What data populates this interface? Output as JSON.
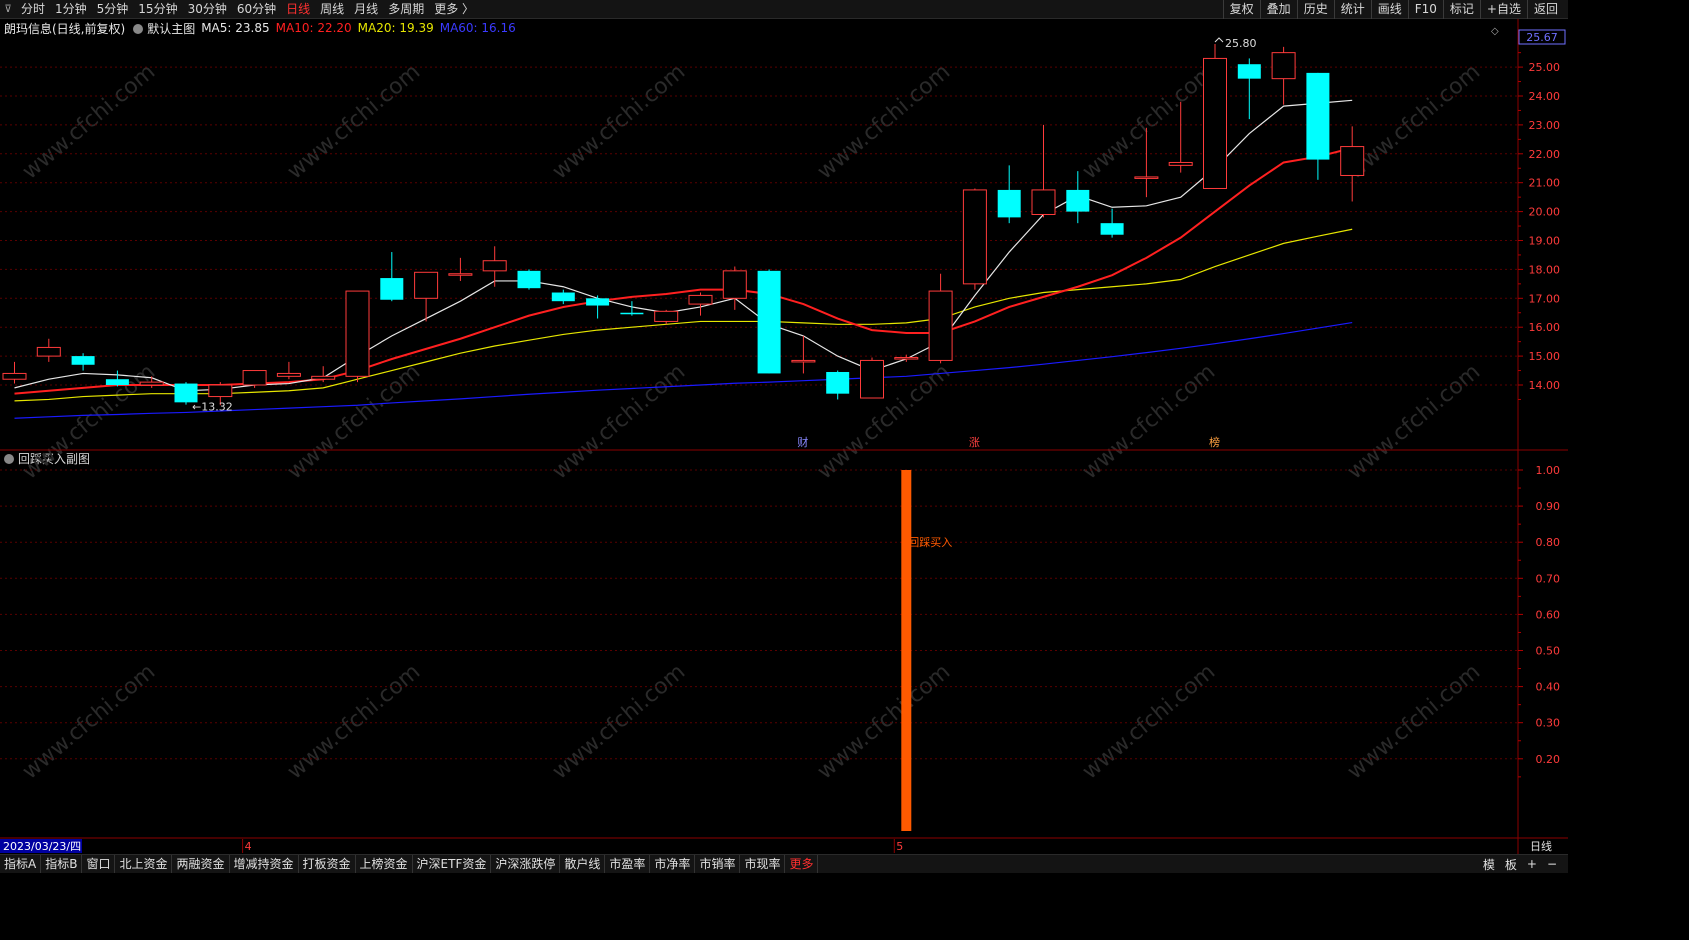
{
  "toolbar": {
    "left": [
      "分时",
      "1分钟",
      "5分钟",
      "15分钟",
      "30分钟",
      "60分钟",
      "日线",
      "周线",
      "月线",
      "多周期",
      "更多 〉"
    ],
    "active": "日线",
    "right": [
      "复权",
      "叠加",
      "历史",
      "统计",
      "画线",
      "F10",
      "标记",
      "+自选",
      "返回"
    ]
  },
  "header": {
    "stock": "朗玛信息(日线,前复权)",
    "main_label": "默认主图",
    "ma5": "MA5: 23.85",
    "ma10": "MA10: 22.20",
    "ma20": "MA20: 19.39",
    "ma60": "MA60: 16.16"
  },
  "subchart_title": "回踩买入副图",
  "bottom_tabs": [
    "指标A",
    "指标B",
    "窗口",
    "北上资金",
    "两融资金",
    "增减持资金",
    "打板资金",
    "上榜资金",
    "沪深ETF资金",
    "沪深涨跌停",
    "散户线",
    "市盈率",
    "市净率",
    "市销率",
    "市现率",
    "更多"
  ],
  "bottom_right": [
    "模",
    "板",
    "+",
    "−"
  ],
  "watermark": "www.cfchi.com",
  "colors": {
    "up": "#ff3b3b",
    "down": "#00ffff",
    "ma5": "#e6e6e6",
    "ma10": "#ff2020",
    "ma20": "#e6e600",
    "ma60": "#1a1aff",
    "signal": "#ff5a00"
  },
  "chart_data": [
    {
      "type": "candlestick",
      "ylim": [
        13.0,
        25.67
      ],
      "y_ticks": [
        "25.00",
        "24.00",
        "23.00",
        "22.00",
        "21.00",
        "20.00",
        "19.00",
        "18.00",
        "17.00",
        "16.00",
        "15.00",
        "14.00"
      ],
      "last_price_label": "25.67",
      "candles": [
        {
          "o": 14.2,
          "h": 14.8,
          "l": 14.05,
          "c": 14.4
        },
        {
          "o": 15.0,
          "h": 15.6,
          "l": 14.8,
          "c": 15.3
        },
        {
          "o": 15.0,
          "h": 15.1,
          "l": 14.5,
          "c": 14.7
        },
        {
          "o": 14.2,
          "h": 14.5,
          "l": 13.95,
          "c": 14.0
        },
        {
          "o": 14.0,
          "h": 14.3,
          "l": 13.9,
          "c": 14.1
        },
        {
          "o": 14.05,
          "h": 14.1,
          "l": 13.32,
          "c": 13.4
        },
        {
          "o": 13.6,
          "h": 14.1,
          "l": 13.3,
          "c": 14.0
        },
        {
          "o": 14.0,
          "h": 14.5,
          "l": 13.9,
          "c": 14.5
        },
        {
          "o": 14.3,
          "h": 14.8,
          "l": 14.2,
          "c": 14.4
        },
        {
          "o": 14.2,
          "h": 14.65,
          "l": 14.1,
          "c": 14.3
        },
        {
          "o": 14.3,
          "h": 17.25,
          "l": 14.1,
          "c": 17.25
        },
        {
          "o": 17.7,
          "h": 18.6,
          "l": 16.9,
          "c": 16.95
        },
        {
          "o": 17.0,
          "h": 17.9,
          "l": 16.2,
          "c": 17.9
        },
        {
          "o": 17.8,
          "h": 18.4,
          "l": 17.6,
          "c": 17.85
        },
        {
          "o": 17.95,
          "h": 18.8,
          "l": 17.4,
          "c": 18.3
        },
        {
          "o": 17.95,
          "h": 18.0,
          "l": 17.3,
          "c": 17.35
        },
        {
          "o": 17.2,
          "h": 17.3,
          "l": 16.8,
          "c": 16.9
        },
        {
          "o": 17.0,
          "h": 17.1,
          "l": 16.3,
          "c": 16.75
        },
        {
          "o": 16.5,
          "h": 16.9,
          "l": 16.4,
          "c": 16.45
        },
        {
          "o": 16.2,
          "h": 16.6,
          "l": 16.1,
          "c": 16.55
        },
        {
          "o": 16.8,
          "h": 17.2,
          "l": 16.4,
          "c": 17.1
        },
        {
          "o": 17.0,
          "h": 18.1,
          "l": 16.6,
          "c": 17.95
        },
        {
          "o": 17.95,
          "h": 18.0,
          "l": 14.4,
          "c": 14.4
        },
        {
          "o": 14.85,
          "h": 15.7,
          "l": 14.4,
          "c": 14.85
        },
        {
          "o": 14.45,
          "h": 14.5,
          "l": 13.5,
          "c": 13.7
        },
        {
          "o": 13.55,
          "h": 14.95,
          "l": 13.55,
          "c": 14.85
        },
        {
          "o": 14.9,
          "h": 15.05,
          "l": 14.8,
          "c": 14.95
        },
        {
          "o": 14.85,
          "h": 17.85,
          "l": 14.75,
          "c": 17.25
        },
        {
          "o": 17.5,
          "h": 20.8,
          "l": 17.3,
          "c": 20.75
        },
        {
          "o": 20.75,
          "h": 21.6,
          "l": 19.6,
          "c": 19.8
        },
        {
          "o": 19.9,
          "h": 23.0,
          "l": 19.8,
          "c": 20.75
        },
        {
          "o": 20.75,
          "h": 21.4,
          "l": 19.6,
          "c": 20.0
        },
        {
          "o": 19.6,
          "h": 20.1,
          "l": 19.1,
          "c": 19.2
        },
        {
          "o": 21.15,
          "h": 22.9,
          "l": 20.5,
          "c": 21.2
        },
        {
          "o": 21.6,
          "h": 23.8,
          "l": 21.35,
          "c": 21.7
        },
        {
          "o": 20.8,
          "h": 25.8,
          "l": 20.8,
          "c": 25.3
        },
        {
          "o": 25.1,
          "h": 25.3,
          "l": 23.2,
          "c": 24.6
        },
        {
          "o": 24.6,
          "h": 25.7,
          "l": 23.7,
          "c": 25.5
        },
        {
          "o": 24.8,
          "h": 24.8,
          "l": 21.1,
          "c": 21.8
        },
        {
          "o": 21.25,
          "h": 22.95,
          "l": 20.35,
          "c": 22.25
        }
      ],
      "ma5": [
        13.9,
        14.2,
        14.4,
        14.35,
        14.25,
        13.8,
        13.85,
        14.0,
        14.05,
        14.25,
        15.0,
        15.7,
        16.3,
        16.9,
        17.6,
        17.6,
        17.4,
        17.0,
        16.7,
        16.5,
        16.7,
        17.0,
        16.1,
        15.7,
        15.0,
        14.5,
        14.9,
        15.5,
        17.1,
        18.6,
        19.9,
        20.55,
        20.15,
        20.2,
        20.5,
        21.5,
        22.7,
        23.65,
        23.75,
        23.85
      ],
      "ma10": [
        13.7,
        13.8,
        13.9,
        14.0,
        14.0,
        14.0,
        14.0,
        14.05,
        14.1,
        14.2,
        14.5,
        14.9,
        15.25,
        15.6,
        16.0,
        16.4,
        16.7,
        16.9,
        17.05,
        17.15,
        17.3,
        17.3,
        17.15,
        16.8,
        16.3,
        15.9,
        15.8,
        15.8,
        16.2,
        16.7,
        17.05,
        17.4,
        17.8,
        18.4,
        19.1,
        20.0,
        20.9,
        21.7,
        21.9,
        22.2
      ],
      "ma20": [
        13.45,
        13.5,
        13.6,
        13.65,
        13.7,
        13.7,
        13.7,
        13.75,
        13.8,
        13.9,
        14.2,
        14.5,
        14.8,
        15.1,
        15.35,
        15.55,
        15.75,
        15.9,
        16.0,
        16.1,
        16.2,
        16.2,
        16.2,
        16.15,
        16.1,
        16.1,
        16.15,
        16.3,
        16.7,
        17.0,
        17.2,
        17.3,
        17.4,
        17.5,
        17.65,
        18.1,
        18.5,
        18.9,
        19.15,
        19.39
      ],
      "ma60": [
        12.85,
        12.9,
        12.95,
        12.98,
        13.02,
        13.05,
        13.1,
        13.15,
        13.2,
        13.25,
        13.3,
        13.38,
        13.45,
        13.52,
        13.6,
        13.68,
        13.75,
        13.82,
        13.88,
        13.94,
        14.0,
        14.06,
        14.1,
        14.15,
        14.2,
        14.25,
        14.3,
        14.4,
        14.5,
        14.6,
        14.72,
        14.85,
        14.98,
        15.12,
        15.27,
        15.43,
        15.6,
        15.78,
        15.97,
        16.16
      ],
      "annotations": [
        {
          "label": "25.80",
          "candle": 35,
          "kind": "high"
        },
        {
          "label": "13.32",
          "candle": 5,
          "kind": "low"
        },
        {
          "label": "财",
          "candle": 23,
          "kind": "event"
        },
        {
          "label": "涨",
          "candle": 28,
          "kind": "event"
        },
        {
          "label": "榜",
          "candle": 35,
          "kind": "event"
        }
      ]
    },
    {
      "type": "bar",
      "title": "回踩买入副图",
      "ylim": [
        0.0,
        1.05
      ],
      "y_ticks": [
        "1.00",
        "0.90",
        "0.80",
        "0.70",
        "0.60",
        "0.50",
        "0.40",
        "0.30",
        "0.20"
      ],
      "series": [
        {
          "name": "回踩买入",
          "values": [
            0,
            0,
            0,
            0,
            0,
            0,
            0,
            0,
            0,
            0,
            0,
            0,
            0,
            0,
            0,
            0,
            0,
            0,
            0,
            0,
            0,
            0,
            0,
            0,
            0,
            0,
            1,
            0,
            0,
            0,
            0,
            0,
            0,
            0,
            0,
            0,
            0,
            0,
            0,
            0
          ]
        }
      ],
      "signal_label": "回踩买入"
    }
  ],
  "x_axis": {
    "date_label": "2023/03/23/四",
    "month_marks": [
      {
        "label": "4",
        "candle": 7
      },
      {
        "label": "5",
        "candle": 26
      }
    ],
    "period_label": "日线"
  }
}
